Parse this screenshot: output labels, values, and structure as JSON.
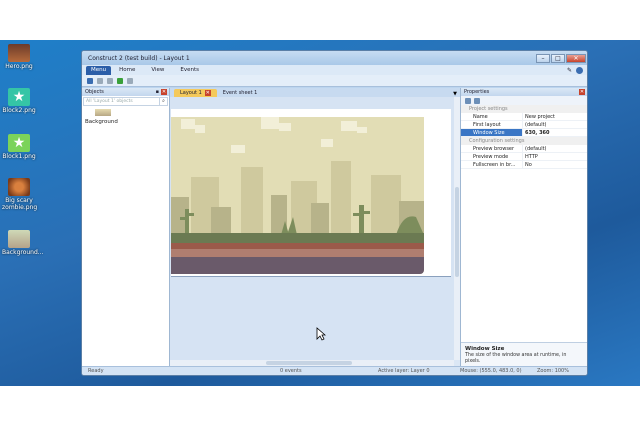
{
  "desktop_icons": [
    {
      "label": "Hero.png",
      "icon": "hero-image-icon"
    },
    {
      "label": "Block2.png",
      "icon": "star-block-icon"
    },
    {
      "label": "Block1.png",
      "icon": "star-block-icon"
    },
    {
      "label": "Big scary zombie.png",
      "icon": "zombie-image-icon"
    },
    {
      "label": "Background...",
      "icon": "background-image-icon"
    }
  ],
  "window": {
    "title": "Construct 2 (test build) - Layout 1",
    "controls": {
      "minimize": "–",
      "maximize": "□",
      "close": "✕"
    }
  },
  "ribbon": {
    "menu": "Menu",
    "tabs": [
      "Home",
      "View",
      "Events"
    ]
  },
  "objects_panel": {
    "title": "Objects",
    "search_placeholder": "All 'Layout 1' objects",
    "items": [
      {
        "label": "Background"
      }
    ]
  },
  "editor_tabs": [
    {
      "label": "Layout 1",
      "active": true
    },
    {
      "label": "Event sheet 1",
      "active": false
    }
  ],
  "properties": {
    "title": "Properties",
    "categories": [
      {
        "label": "Project settings",
        "rows": [
          {
            "key": "Name",
            "value": "New project"
          },
          {
            "key": "First layout",
            "value": "(default)"
          },
          {
            "key": "Window Size",
            "value": "630, 360",
            "selected": true
          }
        ]
      },
      {
        "label": "Configuration settings",
        "rows": [
          {
            "key": "Preview browser",
            "value": "(default)"
          },
          {
            "key": "Preview mode",
            "value": "HTTP"
          },
          {
            "key": "Fullscreen in br...",
            "value": "No"
          }
        ]
      }
    ],
    "help_title": "Window Size",
    "help_text": "The size of the window area at runtime, in pixels."
  },
  "status": {
    "ready": "Ready",
    "events": "0 events",
    "active_layer": "Active layer: Layer 0",
    "mouse": "Mouse: (555.0, 483.0, 0)",
    "zoom": "Zoom: 100%"
  },
  "colors": {
    "accent": "#3a76c5",
    "active_tab": "#f4c95b",
    "desktop": "#2a6fb5"
  }
}
